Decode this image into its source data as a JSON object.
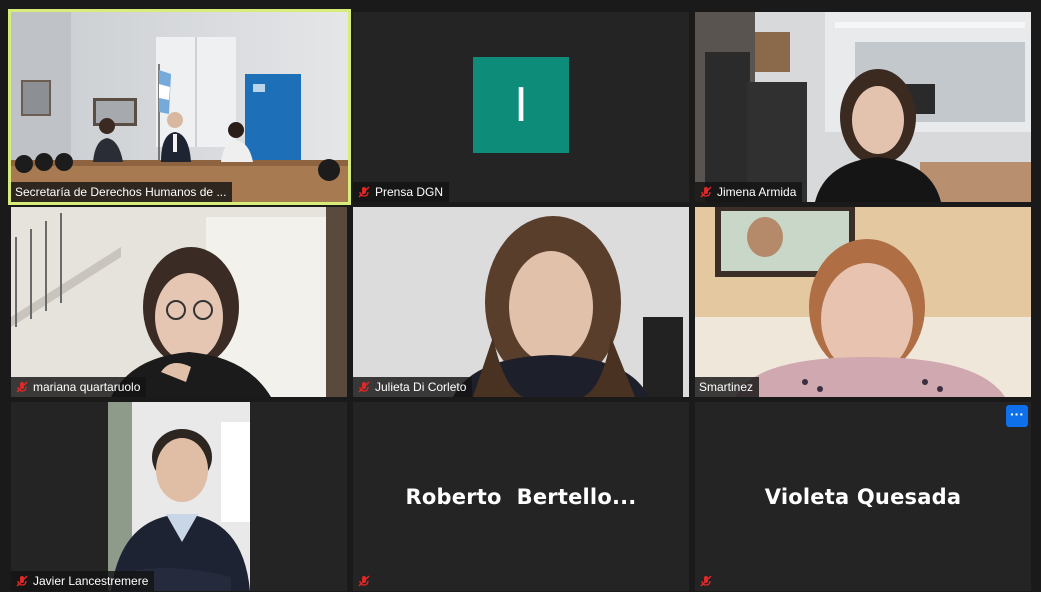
{
  "participants": [
    {
      "name": "Secretaría de Derechos Humanos de ...",
      "muted": false,
      "active_speaker": true
    },
    {
      "name": "Prensa DGN",
      "muted": true,
      "avatar_letter": "I",
      "avatar_color": "#0e8c7a"
    },
    {
      "name": "Jimena Armida",
      "muted": true
    },
    {
      "name": "mariana quartaruolo",
      "muted": true
    },
    {
      "name": "Julieta Di Corleto",
      "muted": true
    },
    {
      "name": "Smartinez",
      "muted": false
    },
    {
      "name": "Javier Lancestremere",
      "muted": true
    },
    {
      "name": "Roberto  Bertello...",
      "muted": true,
      "video": false
    },
    {
      "name": "Violeta Quesada",
      "muted": true,
      "video": false
    }
  ],
  "more_button_label": "···",
  "colors": {
    "active_border": "#d8ec7a",
    "mute_red": "#e02828",
    "tile_bg": "#242424",
    "more_button": "#0e71eb"
  }
}
